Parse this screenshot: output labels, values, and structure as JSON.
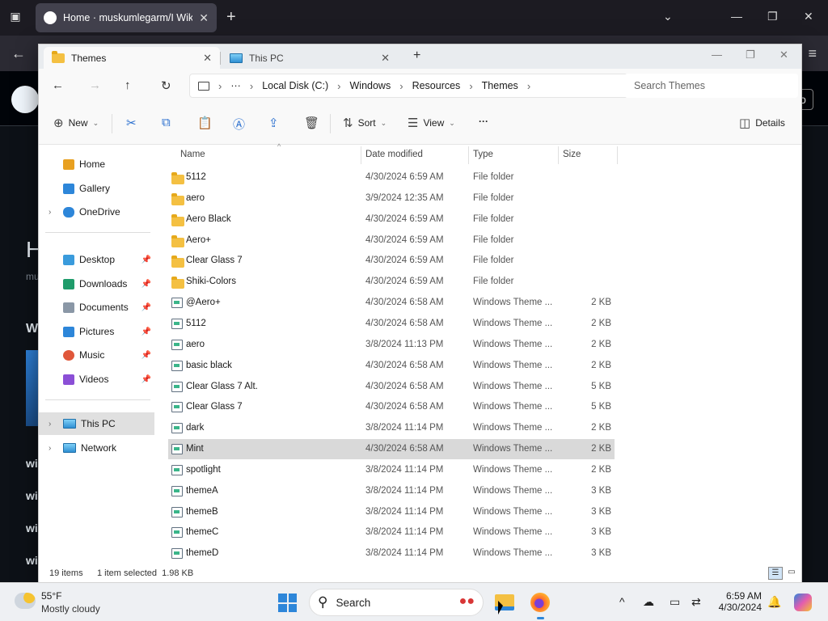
{
  "browser": {
    "tab_title": "Home · muskumlegarm/I Wiki",
    "tab_close": "✕",
    "new_tab": "+",
    "window_controls": [
      "⌄",
      "—",
      "❐",
      "✕"
    ],
    "back": "←",
    "menu": "≡"
  },
  "github_page": {
    "edge_letters": [
      "H",
      "mu",
      "W",
      "wi",
      "wi",
      "wi",
      "wi"
    ],
    "header_button": "o"
  },
  "explorer": {
    "tabs": [
      {
        "label": "Themes",
        "close": "✕"
      },
      {
        "label": "This PC",
        "close": "✕"
      }
    ],
    "add_tab": "+",
    "window_controls": [
      "—",
      "❐",
      "✕"
    ],
    "nav": {
      "back": "←",
      "forward": "→",
      "up": "↑",
      "refresh": "↻"
    },
    "breadcrumbs": [
      "···",
      "Local Disk (C:)",
      "Windows",
      "Resources",
      "Themes"
    ],
    "crumb_sep": "›",
    "search_placeholder": "Search Themes",
    "commands": {
      "new": "New",
      "sort": "Sort",
      "view": "View",
      "more": "···",
      "details": "Details",
      "chev": "⌄"
    },
    "nav_pane": [
      {
        "label": "Home",
        "icon": "home-icon",
        "color": "#e8a020"
      },
      {
        "label": "Gallery",
        "icon": "gallery-icon",
        "color": "#2d86d9"
      },
      {
        "label": "OneDrive",
        "icon": "onedrive-icon",
        "color": "#2d86d9",
        "expand": "›"
      },
      {
        "label": "Desktop",
        "icon": "desktop-icon",
        "color": "#3a9bdc",
        "pin": "📌"
      },
      {
        "label": "Downloads",
        "icon": "downloads-icon",
        "color": "#1f9c6b",
        "pin": "📌"
      },
      {
        "label": "Documents",
        "icon": "documents-icon",
        "color": "#8a97a6",
        "pin": "📌"
      },
      {
        "label": "Pictures",
        "icon": "pictures-icon",
        "color": "#2d86d9",
        "pin": "📌"
      },
      {
        "label": "Music",
        "icon": "music-icon",
        "color": "#e0573a",
        "pin": "📌"
      },
      {
        "label": "Videos",
        "icon": "videos-icon",
        "color": "#8b4fd6",
        "pin": "📌"
      },
      {
        "label": "This PC",
        "icon": "this-pc-icon",
        "color": "#2f8fd3",
        "expand": "›",
        "selected": true
      },
      {
        "label": "Network",
        "icon": "network-icon",
        "color": "#2f8fd3",
        "expand": "›"
      }
    ],
    "columns": [
      "Name",
      "Date modified",
      "Type",
      "Size"
    ],
    "sort_indicator": "^",
    "files": [
      {
        "name": "5112",
        "date": "4/30/2024 6:59 AM",
        "type": "File folder",
        "size": "",
        "kind": "folder"
      },
      {
        "name": "aero",
        "date": "3/9/2024 12:35 AM",
        "type": "File folder",
        "size": "",
        "kind": "folder"
      },
      {
        "name": "Aero Black",
        "date": "4/30/2024 6:59 AM",
        "type": "File folder",
        "size": "",
        "kind": "folder"
      },
      {
        "name": "Aero+",
        "date": "4/30/2024 6:59 AM",
        "type": "File folder",
        "size": "",
        "kind": "folder"
      },
      {
        "name": "Clear Glass 7",
        "date": "4/30/2024 6:59 AM",
        "type": "File folder",
        "size": "",
        "kind": "folder"
      },
      {
        "name": "Shiki-Colors",
        "date": "4/30/2024 6:59 AM",
        "type": "File folder",
        "size": "",
        "kind": "folder"
      },
      {
        "name": "@Aero+",
        "date": "4/30/2024 6:58 AM",
        "type": "Windows Theme ...",
        "size": "2 KB",
        "kind": "theme"
      },
      {
        "name": "5112",
        "date": "4/30/2024 6:58 AM",
        "type": "Windows Theme ...",
        "size": "2 KB",
        "kind": "theme"
      },
      {
        "name": "aero",
        "date": "3/8/2024 11:13 PM",
        "type": "Windows Theme ...",
        "size": "2 KB",
        "kind": "theme"
      },
      {
        "name": "basic black",
        "date": "4/30/2024 6:58 AM",
        "type": "Windows Theme ...",
        "size": "2 KB",
        "kind": "theme"
      },
      {
        "name": "Clear Glass 7 Alt.",
        "date": "4/30/2024 6:58 AM",
        "type": "Windows Theme ...",
        "size": "5 KB",
        "kind": "theme"
      },
      {
        "name": "Clear Glass 7",
        "date": "4/30/2024 6:58 AM",
        "type": "Windows Theme ...",
        "size": "5 KB",
        "kind": "theme"
      },
      {
        "name": "dark",
        "date": "3/8/2024 11:14 PM",
        "type": "Windows Theme ...",
        "size": "2 KB",
        "kind": "theme"
      },
      {
        "name": "Mint",
        "date": "4/30/2024 6:58 AM",
        "type": "Windows Theme ...",
        "size": "2 KB",
        "kind": "theme",
        "selected": true
      },
      {
        "name": "spotlight",
        "date": "3/8/2024 11:14 PM",
        "type": "Windows Theme ...",
        "size": "2 KB",
        "kind": "theme"
      },
      {
        "name": "themeA",
        "date": "3/8/2024 11:14 PM",
        "type": "Windows Theme ...",
        "size": "3 KB",
        "kind": "theme"
      },
      {
        "name": "themeB",
        "date": "3/8/2024 11:14 PM",
        "type": "Windows Theme ...",
        "size": "3 KB",
        "kind": "theme"
      },
      {
        "name": "themeC",
        "date": "3/8/2024 11:14 PM",
        "type": "Windows Theme ...",
        "size": "3 KB",
        "kind": "theme"
      },
      {
        "name": "themeD",
        "date": "3/8/2024 11:14 PM",
        "type": "Windows Theme ...",
        "size": "3 KB",
        "kind": "theme"
      }
    ],
    "status": {
      "items": "19 items",
      "selected": "1 item selected  1.98 KB"
    }
  },
  "taskbar": {
    "weather_temp": "55°F",
    "weather_desc": "Mostly cloudy",
    "search_label": "Search",
    "search_icon": "⚲",
    "clock_time": "6:59 AM",
    "clock_date": "4/30/2024",
    "tray_icons": [
      "^",
      "☁",
      "▭",
      "⇄",
      "🔔"
    ]
  },
  "colors": {
    "accent": "#2d86d9",
    "selection": "#d9d9d9",
    "folder": "#f4c042"
  }
}
